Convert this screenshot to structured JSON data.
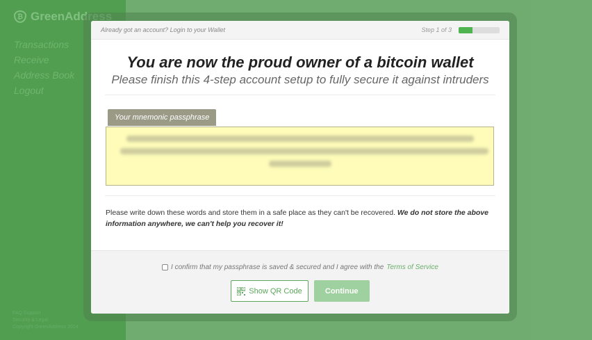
{
  "app": {
    "name": "GreenAddress"
  },
  "nav": [
    "Transactions",
    "Receive",
    "Address Book",
    "Logout"
  ],
  "footer_lines": [
    "FAQ Support",
    "Security & Legal",
    "Copyright GreenAddress 2014"
  ],
  "modal": {
    "login_link": "Already got an account? Login to your Wallet",
    "step_text": "Step 1 of 3",
    "progress_fraction": 0.333,
    "headline": "You are now the proud owner of a bitcoin wallet",
    "subline": "Please finish this 4-step account setup to fully secure it against intruders",
    "phrase_label": "Your mnemonic passphrase",
    "warning_text": "Please write down these words and store them in a safe place as they can't be recovered. ",
    "warning_bold": "We do not store the above information anywhere, we can't help you recover it!",
    "confirm_text": "I confirm that my passphrase is saved & secured and I agree with the ",
    "tos_link": "Terms of Service",
    "qr_button": "Show QR Code",
    "continue_button": "Continue"
  },
  "colors": {
    "brand_green": "#55a755",
    "phrase_bg": "#fefcb8",
    "continue_disabled": "#9fd09f"
  }
}
